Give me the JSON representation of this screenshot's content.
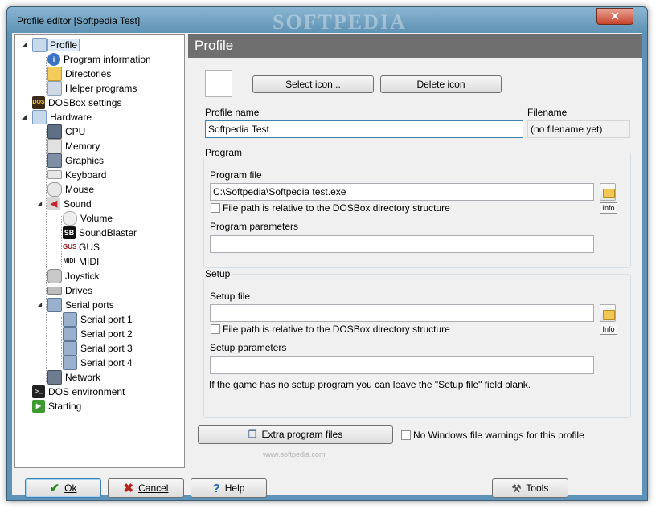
{
  "window": {
    "title": "Profile editor [Softpedia Test]",
    "watermark": "SOFTPEDIA",
    "close_label": "✕"
  },
  "tree": {
    "profile": "Profile",
    "program_information": "Program information",
    "directories": "Directories",
    "helper_programs": "Helper programs",
    "dosbox_settings": "DOSBox settings",
    "hardware": "Hardware",
    "cpu": "CPU",
    "memory": "Memory",
    "graphics": "Graphics",
    "keyboard": "Keyboard",
    "mouse": "Mouse",
    "sound": "Sound",
    "volume": "Volume",
    "soundblaster": "SoundBlaster",
    "gus": "GUS",
    "midi": "MIDI",
    "joystick": "Joystick",
    "drives": "Drives",
    "serial_ports": "Serial ports",
    "serial_port_1": "Serial port 1",
    "serial_port_2": "Serial port 2",
    "serial_port_3": "Serial port 3",
    "serial_port_4": "Serial port 4",
    "network": "Network",
    "dos_environment": "DOS environment",
    "starting": "Starting"
  },
  "panel": {
    "title": "Profile",
    "select_icon": "Select icon...",
    "delete_icon": "Delete icon",
    "profile_name_label": "Profile name",
    "profile_name_value": "Softpedia Test",
    "filename_label": "Filename",
    "filename_value": "(no filename yet)"
  },
  "program": {
    "group_title": "Program",
    "file_label": "Program file",
    "file_value": "C:\\Softpedia\\Softpedia test.exe",
    "relative_label": "File path is relative to the DOSBox directory structure",
    "info": "Info",
    "params_label": "Program parameters",
    "params_value": ""
  },
  "setup": {
    "group_title": "Setup",
    "file_label": "Setup file",
    "file_value": "",
    "relative_label": "File path is relative to the DOSBox directory structure",
    "info": "Info",
    "params_label": "Setup parameters",
    "params_value": "",
    "hint": "If the game has no setup program you can leave the \"Setup file\" field blank."
  },
  "extra": {
    "extra_files": "Extra program files",
    "no_warnings": "No Windows file warnings for this profile",
    "watermark": "www.softpedia.com"
  },
  "buttons": {
    "ok": "Ok",
    "cancel": "Cancel",
    "help": "Help",
    "tools": "Tools"
  },
  "colors": {
    "ok_check": "#2a8a1f",
    "cancel_x": "#b5261e",
    "help_q": "#2060b0",
    "header_bg": "#6f6f6f"
  }
}
